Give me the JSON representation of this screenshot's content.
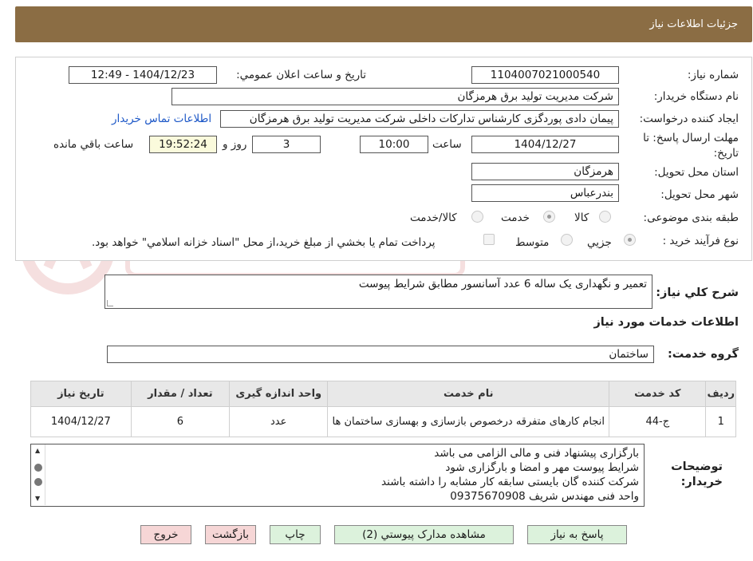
{
  "header": {
    "title": "جزئيات اطلاعات نياز"
  },
  "fields": {
    "need_number_label": "شماره نياز:",
    "need_number": "1104007021000540",
    "announce_label": "تاريخ و ساعت اعلان عمومي:",
    "announce_value": "1404/12/23 - 12:49",
    "buyer_org_label": "نام دستگاه خريدار:",
    "buyer_org": "شرکت مدیریت تولید برق هرمزگان",
    "requester_label": "ايجاد کننده درخواست:",
    "requester": "پیمان دادی پوردگزی کارشناس تدارکات داخلی شرکت مدیریت تولید برق هرمزگان",
    "contact_link": "اطلاعات تماس خريدار",
    "deadline_label_1": "مهلت ارسال پاسخ: تا",
    "deadline_label_2": "تاريخ:",
    "deadline_date": "1404/12/27",
    "time_label": "ساعت",
    "deadline_time": "10:00",
    "days_value": "3",
    "days_label": "روز و",
    "remaining_time": "19:52:24",
    "remaining_label": "ساعت باقي مانده",
    "province_label": "استان محل تحويل:",
    "province": "هرمزگان",
    "city_label": "شهر محل تحويل:",
    "city": "بندرعباس",
    "category_label": "طبقه بندی موضوعی:",
    "category_options": [
      "کالا",
      "خدمت",
      "کالا/خدمت"
    ],
    "category_selected": "خدمت",
    "process_label": "نوع فرآيند خريد :",
    "process_options": [
      "جزيي",
      "متوسط"
    ],
    "process_selected": "جزيي",
    "payment_note": "پرداخت تمام يا بخشي از مبلغ خريد،از محل \"اسناد خزانه اسلامي\" خواهد بود."
  },
  "description": {
    "label": "شرح کلي نياز:",
    "value": "تعمیر و نگهداری یک ساله 6 عدد آسانسور مطابق شرایط پیوست"
  },
  "services_section_title": "اطلاعات خدمات مورد نياز",
  "service_group": {
    "label": "گروه خدمت:",
    "value": "ساختمان"
  },
  "table": {
    "headers": [
      "رديف",
      "کد خدمت",
      "نام خدمت",
      "واحد اندازه گيری",
      "تعداد / مقدار",
      "تاريخ نياز"
    ],
    "rows": [
      [
        "1",
        "ج-44",
        "انجام کارهای متفرقه درخصوص بازسازی و بهسازی ساختمان ها",
        "عدد",
        "6",
        "1404/12/27"
      ]
    ]
  },
  "buyer_notes": {
    "label_1": "توضيحات",
    "label_2": "خريدار:",
    "lines": [
      "بارگزاری پیشنهاد فنی و مالی الزامی می باشد",
      "شرایط پیوست مهر و امضا و بارگزاری شود",
      "شرکت کننده گان بایستی سابقه کار مشابه را داشته باشند",
      "واحد فنی مهندس شریف 09375670908"
    ]
  },
  "buttons": {
    "reply": "پاسخ به نياز",
    "attachments": "مشاهده مدارک پيوستي (2)",
    "print": "چاپ",
    "back": "بازگشت",
    "exit": "خروج"
  },
  "colors": {
    "header_bg": "#8b6d44",
    "link": "#1c57c7",
    "green_button": "#dcf2dc",
    "pink_button": "#f6d6d6",
    "remaining_bg": "#fafadc"
  }
}
